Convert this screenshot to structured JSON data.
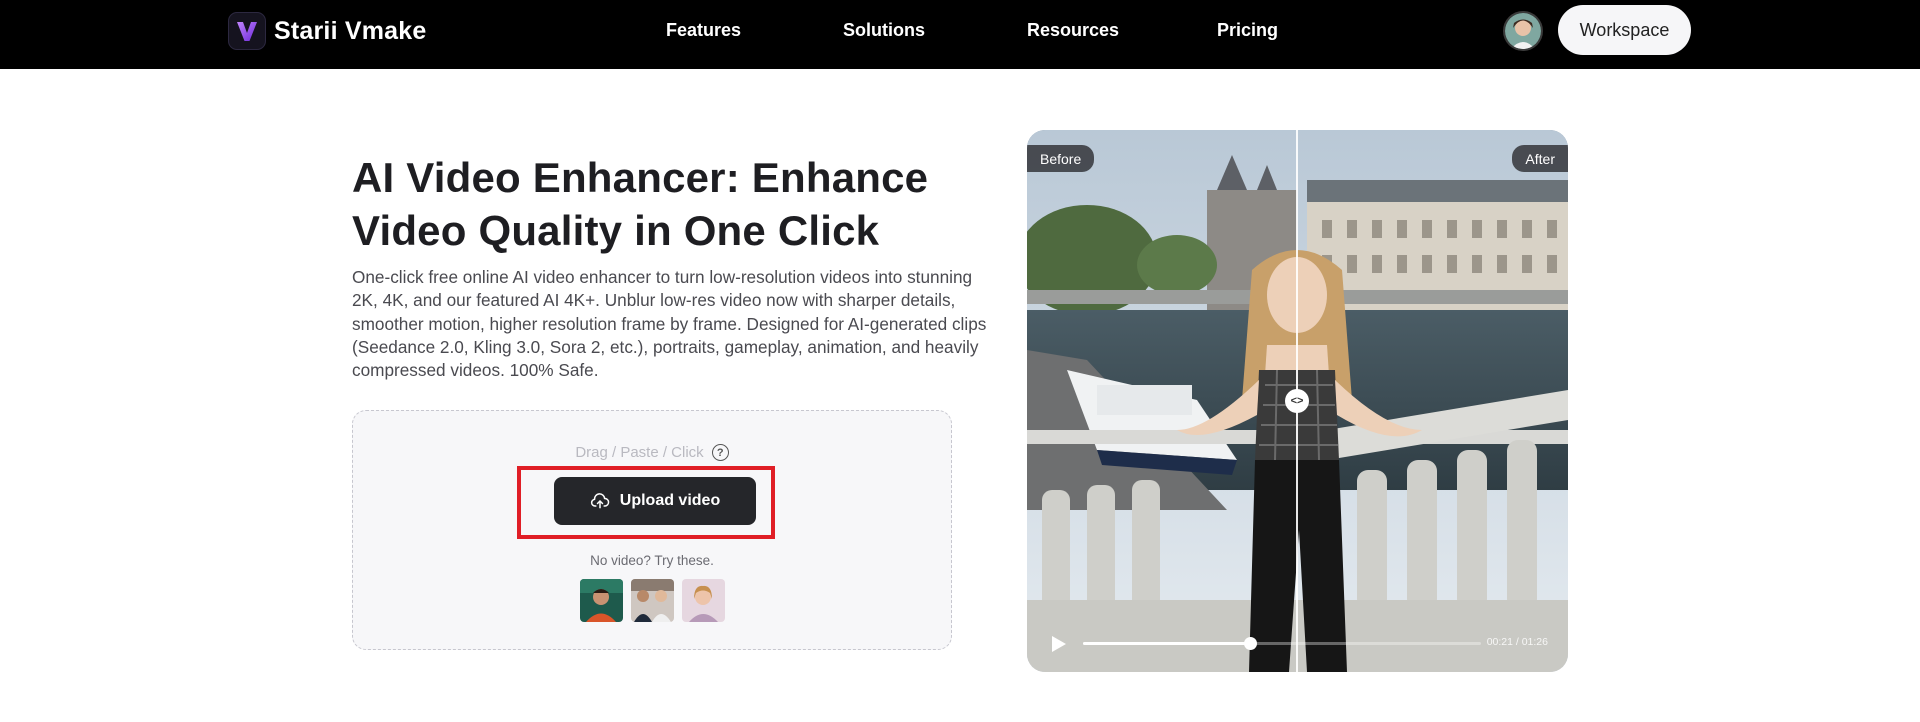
{
  "nav": {
    "brand": "Starii Vmake",
    "items": [
      "Features",
      "Solutions",
      "Resources",
      "Pricing"
    ],
    "workspace_label": "Workspace"
  },
  "hero": {
    "title": "AI Video Enhancer: Enhance Video Quality in One Click",
    "description": "One-click free online AI video enhancer to turn low-resolution videos into stunning 2K, 4K, and our featured AI 4K+. Unblur low-res video now with sharper details, smoother motion, higher resolution frame by frame. Designed for AI-generated clips (Seedance 2.0, Kling 3.0, Sora 2, etc.), portraits, gameplay, animation, and heavily compressed videos. 100% Safe."
  },
  "upload": {
    "hint": "Drag / Paste / Click",
    "button_label": "Upload video",
    "try_text": "No video? Try these.",
    "samples": [
      "sample-video-1",
      "sample-video-2",
      "sample-video-3"
    ]
  },
  "preview": {
    "before_label": "Before",
    "after_label": "After",
    "time": "00:21 / 01:26",
    "progress_fraction": 0.42,
    "compare_split_fraction": 0.5
  },
  "colors": {
    "nav_bg": "#000000",
    "button_dark": "#25262a",
    "highlight": "#e01e26",
    "brand_accent": "#a855f7"
  }
}
